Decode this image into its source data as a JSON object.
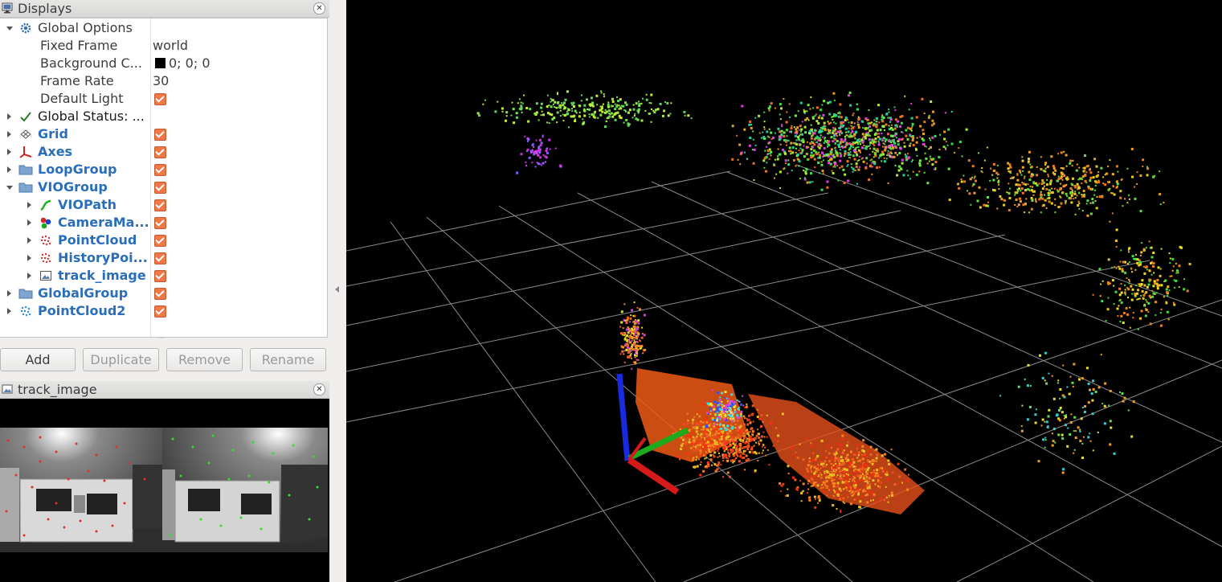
{
  "displays_panel": {
    "title": "Displays",
    "close_glyph": "✕",
    "global_options": {
      "label": "Global Options",
      "fixed_frame_label": "Fixed Frame",
      "fixed_frame_value": "world",
      "background_color_label": "Background C...",
      "background_color_value": "0; 0; 0",
      "frame_rate_label": "Frame Rate",
      "frame_rate_value": "30",
      "default_light_label": "Default Light",
      "default_light_checked": true
    },
    "global_status_label": "Global Status: ...",
    "items": [
      {
        "label": "Grid",
        "icon": "grid-icon",
        "checked": true
      },
      {
        "label": "Axes",
        "icon": "axes-icon",
        "checked": true
      },
      {
        "label": "LoopGroup",
        "icon": "folder-icon",
        "checked": true
      },
      {
        "label": "VIOGroup",
        "icon": "folder-icon",
        "checked": true,
        "expanded": true
      },
      {
        "label": "VIOPath",
        "icon": "path-icon",
        "checked": true
      },
      {
        "label": "CameraMa...",
        "icon": "marker-icon",
        "checked": true
      },
      {
        "label": "PointCloud",
        "icon": "pointcloud-icon",
        "checked": true
      },
      {
        "label": "HistoryPoi...",
        "icon": "pointcloud-icon",
        "checked": true
      },
      {
        "label": "track_image",
        "icon": "image-icon",
        "checked": true
      },
      {
        "label": "GlobalGroup",
        "icon": "folder-icon",
        "checked": true
      },
      {
        "label": "PointCloud2",
        "icon": "pointcloud2-icon",
        "checked": true
      }
    ],
    "buttons": {
      "add": "Add",
      "duplicate": "Duplicate",
      "remove": "Remove",
      "rename": "Rename"
    }
  },
  "track_panel": {
    "title": "track_image",
    "close_glyph": "✕"
  },
  "colors": {
    "link_blue": "#2a6ebb",
    "checkbox_orange": "#f07746",
    "viewport_bg": "#000000",
    "grid_line": "#8a8a8a"
  }
}
